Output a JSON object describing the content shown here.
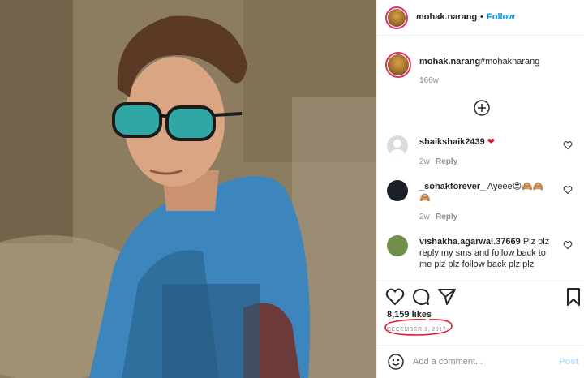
{
  "header": {
    "username": "mohak.narang",
    "separator": "•",
    "follow_label": "Follow"
  },
  "caption": {
    "username": "mohak.narang",
    "hashtag": "#mohaknarang",
    "time": "166w"
  },
  "comments": [
    {
      "username": "shaikshaik2439",
      "text": "❤",
      "time": "2w",
      "reply": "Reply"
    },
    {
      "username": "_sohakforever_",
      "text": "Ayeee😍🙈🙈",
      "text_line2": "🙈",
      "time": "2w",
      "reply": "Reply"
    },
    {
      "username": "vishakha.agarwal.37669",
      "text": "Plz plz",
      "text_line2": "reply my sms and follow back to",
      "text_line3": "me plz plz follow back plz plz"
    }
  ],
  "actions": {
    "likes": "8,159 likes",
    "date": "DECEMBER 3, 2017"
  },
  "add_comment": {
    "placeholder": "Add a comment...",
    "post_label": "Post"
  },
  "icons": {
    "like": "heart-icon",
    "comment": "comment-icon",
    "share": "share-icon",
    "save": "bookmark-icon",
    "emoji": "smiley-icon",
    "load_more": "plus-circle-icon"
  },
  "colors": {
    "follow": "#0095f6",
    "hashtag": "#00376b",
    "annotation": "#e0182d",
    "post_disabled": "#b2dffc"
  }
}
